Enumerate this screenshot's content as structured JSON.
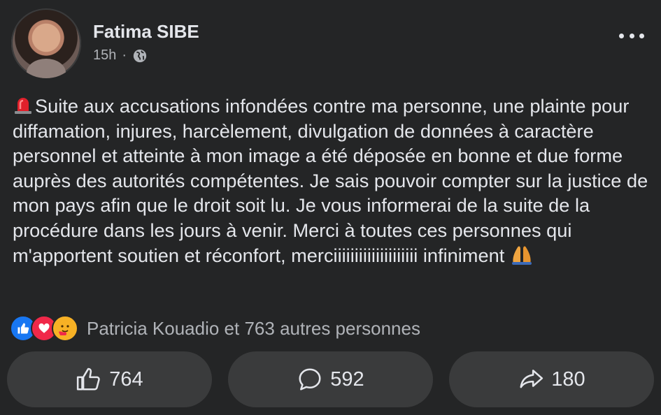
{
  "post": {
    "author": "Fatima SIBE",
    "time": "15h",
    "separator": "·",
    "privacy_icon": "globe-icon",
    "more_icon": "more-options-icon",
    "text": "Suite aux accusations infondées contre ma personne, une plainte pour diffamation, injures, harcèlement, divulgation de données à caractère personnel et atteinte à mon image a été déposée en bonne et due forme auprès des autorités compétentes. Je sais pouvoir compter sur la justice de mon pays afin que le droit soit lu. Je vous informerai de la suite de la procédure dans les jours à venir. Merci à toutes ces personnes qui m'apportent soutien et réconfort, merciiiiiiiiiiiiiiiiiiii infiniment",
    "lead_emoji": "siren-emoji",
    "trail_emoji": "praying-hands-emoji"
  },
  "reactions": {
    "types": [
      "like",
      "love",
      "care"
    ],
    "summary": "Patricia Kouadio et 763 autres personnes"
  },
  "actions": {
    "like_count": "764",
    "comment_count": "592",
    "share_count": "180"
  },
  "colors": {
    "background": "#242526",
    "button_bg": "#3a3b3c",
    "text": "#e4e6eb",
    "secondary_text": "#b0b3b8",
    "like_blue": "#1877f2",
    "love_red": "#f02849",
    "care_yellow": "#f7b125"
  }
}
